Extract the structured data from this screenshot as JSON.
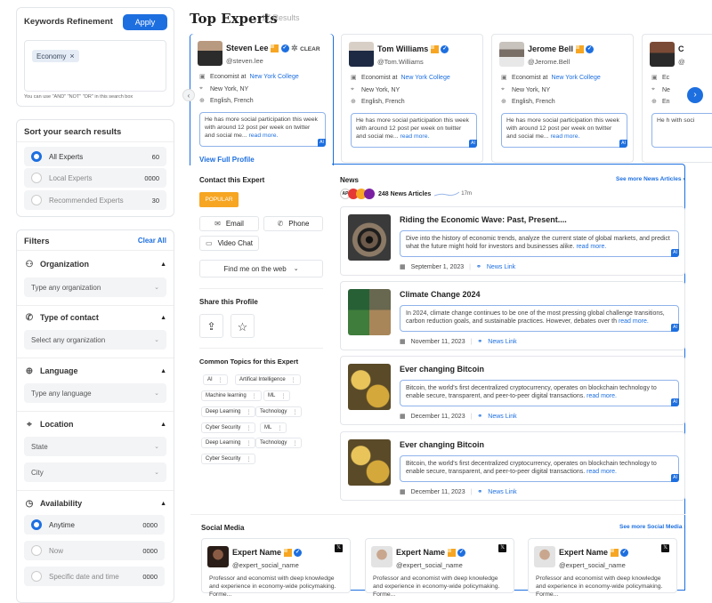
{
  "keywords": {
    "title": "Keywords Refinement",
    "apply_label": "Apply",
    "chips": [
      "Economy"
    ],
    "hint": "You can use \"AND\" \"NOT\" \"OR\" in this search box"
  },
  "sort": {
    "title": "Sort your search results",
    "options": [
      {
        "label": "All Experts",
        "count": "60",
        "selected": true
      },
      {
        "label": "Local Experts",
        "count": "0000",
        "selected": false
      },
      {
        "label": "Recommended Experts",
        "count": "30",
        "selected": false
      }
    ]
  },
  "filters": {
    "title": "Filters",
    "clear_label": "Clear All",
    "organization": {
      "label": "Organization",
      "placeholder": "Type any organization"
    },
    "contact": {
      "label": "Type of contact",
      "placeholder": "Select any organization"
    },
    "language": {
      "label": "Language",
      "placeholder": "Type any language"
    },
    "location": {
      "label": "Location",
      "state": "State",
      "city": "City"
    },
    "availability": {
      "label": "Availability",
      "options": [
        {
          "label": "Anytime",
          "count": "0000",
          "selected": true
        },
        {
          "label": "Now",
          "count": "0000",
          "selected": false
        },
        {
          "label": "Specific date and time",
          "count": "0000",
          "selected": false
        }
      ]
    }
  },
  "header": {
    "title": "Top Experts",
    "results": "17 Results"
  },
  "experts": [
    {
      "name": "Steven Lee",
      "handle": "@steven.lee",
      "role": "Economist at",
      "org": "New York College",
      "location": "New York, NY",
      "languages": "English, French",
      "bio": "He has more social participation this week with around 12 post per week on twitter and social me...",
      "more": "read more.",
      "clear_label": "CLEAR"
    },
    {
      "name": "Tom Williams",
      "handle": "@Tom.Williams",
      "role": "Economist at",
      "org": "New York College",
      "location": "New York, NY",
      "languages": "English, French",
      "bio": "He has more social participation this week with around 12 post per week on twitter and social me...",
      "more": "read more."
    },
    {
      "name": "Jerome Bell",
      "handle": "@Jerome.Bell",
      "role": "Economist at",
      "org": "New York College",
      "location": "New York, NY",
      "languages": "English, French",
      "bio": "He has more social participation this week with around 12 post per week on twitter and social me...",
      "more": "read more."
    },
    {
      "name": "C",
      "handle": "@",
      "role": "Ec",
      "org": "",
      "location": "Ne",
      "languages": "En",
      "bio": "He h with soci",
      "more": ""
    }
  ],
  "ai_badge": "AI",
  "profile": {
    "view_full": "View Full Profile",
    "contact_title": "Contact this Expert",
    "popular": "POPULAR",
    "email": "Email",
    "phone": "Phone",
    "video": "Video Chat",
    "find_web": "Find me on the web",
    "share_title": "Share this Profile",
    "topics_title": "Common Topics for this Expert",
    "topics": [
      "AI",
      "Artifical Intelligence",
      "Machine learning",
      "ML",
      "Deep Learning",
      "Technology",
      "Cyber Security",
      "ML",
      "Deep Learning",
      "Technology",
      "Cyber Security"
    ]
  },
  "news": {
    "title": "News",
    "see_more": "See more News Articles",
    "count_text": "248 News Articles",
    "followers": "17m",
    "articles": [
      {
        "title": "Riding the Economic Wave: Past, Present....",
        "body": "Dive into the history of economic trends, analyze the current state of global markets, and predict what the future might hold for investors and businesses alike.",
        "more": "read more.",
        "date": "September 1, 2023",
        "link": "News Link"
      },
      {
        "title": "Climate Change 2024",
        "body": "In 2024, climate change continues to be one of the most pressing global challenge transitions, carbon reduction goals, and sustainable practices. However, debates over th",
        "more": "read more.",
        "date": "November 11, 2023",
        "link": "News Link"
      },
      {
        "title": "Ever changing Bitcoin",
        "body": "Bitcoin, the world's first decentralized cryptocurrency, operates on blockchain technology to enable secure, transparent, and peer-to-peer digital transactions.",
        "more": "read more.",
        "date": "December 11, 2023",
        "link": "News Link"
      },
      {
        "title": "Ever changing Bitcoin",
        "body": "Bitcoin, the world's first decentralized cryptocurrency, operates on blockchain technology to enable secure, transparent, and peer-to-peer digital transactions.",
        "more": "read more.",
        "date": "December 11, 2023",
        "link": "News Link"
      }
    ]
  },
  "social": {
    "title": "Social Media",
    "see_more": "See more Social Media",
    "cards": [
      {
        "name": "Expert Name",
        "handle": "@expert_social_name",
        "bio": "Professor and economist with deep knowledge and experience in economy-wide policymaking. Forme..."
      },
      {
        "name": "Expert Name",
        "handle": "@expert_social_name",
        "bio": "Professor and economist with deep knowledge and experience in economy-wide policymaking. Forme..."
      },
      {
        "name": "Expert Name",
        "handle": "@expert_social_name",
        "bio": "Professor and economist with deep knowledge and experience in economy-wide policymaking. Forme..."
      }
    ]
  },
  "colors": {
    "accent": "#1d6fe0",
    "popular": "#f6a623"
  }
}
